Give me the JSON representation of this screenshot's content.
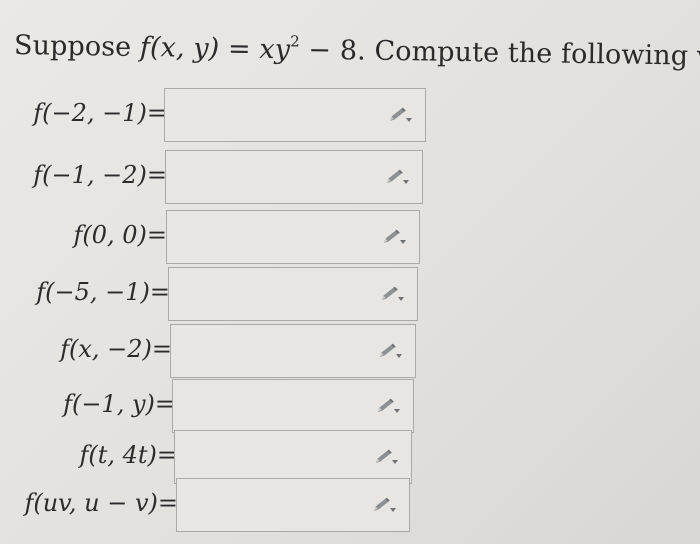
{
  "prompt": {
    "prefix": "Suppose ",
    "function_lhs": "f(x, y) = xy",
    "exponent": "2",
    "function_rhs": " − 8",
    "suffix": ". Compute the following values:"
  },
  "rows": [
    {
      "label": "f(−2, −1)="
    },
    {
      "label": "f(−1, −2)="
    },
    {
      "label": "f(0, 0)="
    },
    {
      "label": "f(−5, −1)="
    },
    {
      "label": "f(x, −2)="
    },
    {
      "label": "f(−1, y)="
    },
    {
      "label": "f(t, 4t)="
    },
    {
      "label": "f(uv, u − v)="
    }
  ],
  "icons": {
    "edit": "pencil-icon"
  },
  "colors": {
    "page": "#e6e4e1",
    "box": "#e7e6e3",
    "box_border": "#a9aaa8",
    "icon": "#8a8c8e"
  }
}
